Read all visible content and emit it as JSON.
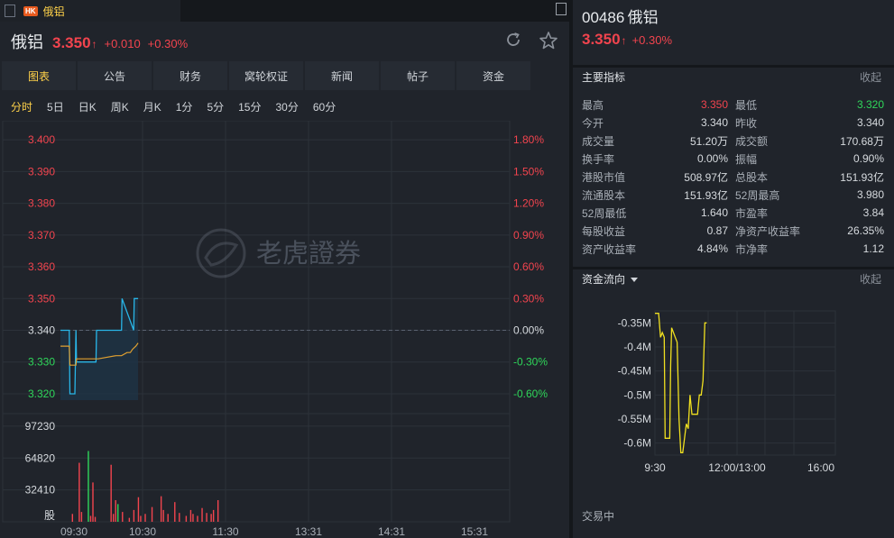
{
  "window": {
    "tab_badge": "HK",
    "tab_title": "俄铝"
  },
  "stock": {
    "name": "俄铝",
    "code": "00486",
    "price": "3.350",
    "change": "+0.010",
    "change_pct": "+0.30%",
    "arrow": "↑"
  },
  "nav_tabs": [
    "图表",
    "公告",
    "财务",
    "窝轮权证",
    "新闻",
    "帖子",
    "资金"
  ],
  "periods": [
    "分时",
    "5日",
    "日K",
    "周K",
    "月K",
    "1分",
    "5分",
    "15分",
    "30分",
    "60分"
  ],
  "watermark": "老虎證券",
  "chart_data": [
    {
      "type": "line",
      "y_ticks": [
        "3.400",
        "3.390",
        "3.380",
        "3.370",
        "3.360",
        "3.350",
        "3.340",
        "3.330",
        "3.320"
      ],
      "pct_ticks": [
        "1.80%",
        "1.50%",
        "1.20%",
        "0.90%",
        "0.60%",
        "0.30%",
        "0.00%",
        "-0.30%",
        "-0.60%"
      ],
      "x_ticks": [
        "09:30",
        "10:30",
        "11:30",
        "13:31",
        "14:31",
        "15:31"
      ],
      "ylim": [
        3.318,
        3.406
      ],
      "prev_close": 3.34,
      "series": [
        {
          "x": [
            0,
            8,
            8.5,
            12,
            13,
            14,
            14.5,
            24,
            24.5,
            32,
            32.5,
            37,
            37.5,
            49,
            50,
            55,
            55.5,
            66,
            66.5,
            70
          ],
          "values": [
            3.34,
            3.34,
            3.32,
            3.32,
            3.32,
            3.34,
            3.33,
            3.33,
            3.33,
            3.33,
            3.34,
            3.34,
            3.34,
            3.34,
            3.34,
            3.34,
            3.35,
            3.34,
            3.35,
            3.35
          ]
        },
        {
          "x": [
            0,
            8,
            8.5,
            14,
            14.5,
            24,
            34,
            50,
            55,
            60,
            63,
            65,
            68,
            70
          ],
          "values": [
            3.335,
            3.335,
            3.329,
            3.329,
            3.331,
            3.331,
            3.331,
            3.332,
            3.332,
            3.333,
            3.333,
            3.334,
            3.335,
            3.336
          ]
        }
      ]
    },
    {
      "type": "bar",
      "y_ticks": [
        "97230",
        "64820",
        "32410",
        "股"
      ],
      "ylim": [
        0,
        110000
      ],
      "bars": [
        {
          "x": 5,
          "v": 8000,
          "c": "red"
        },
        {
          "x": 8,
          "v": 60000,
          "c": "red"
        },
        {
          "x": 9,
          "v": 10000,
          "c": "red"
        },
        {
          "x": 12,
          "v": 72000,
          "c": "green"
        },
        {
          "x": 13,
          "v": 6000,
          "c": "red"
        },
        {
          "x": 14,
          "v": 40000,
          "c": "red"
        },
        {
          "x": 15,
          "v": 5000,
          "c": "red"
        },
        {
          "x": 22,
          "v": 58000,
          "c": "red"
        },
        {
          "x": 23,
          "v": 8000,
          "c": "red"
        },
        {
          "x": 24,
          "v": 22000,
          "c": "red"
        },
        {
          "x": 25,
          "v": 18000,
          "c": "green"
        },
        {
          "x": 27,
          "v": 10000,
          "c": "red"
        },
        {
          "x": 30,
          "v": 4000,
          "c": "red"
        },
        {
          "x": 32,
          "v": 12000,
          "c": "red"
        },
        {
          "x": 34,
          "v": 25000,
          "c": "red"
        },
        {
          "x": 35,
          "v": 6000,
          "c": "red"
        },
        {
          "x": 37,
          "v": 8000,
          "c": "red"
        },
        {
          "x": 40,
          "v": 15000,
          "c": "red"
        },
        {
          "x": 44,
          "v": 26000,
          "c": "red"
        },
        {
          "x": 45,
          "v": 12000,
          "c": "red"
        },
        {
          "x": 47,
          "v": 8000,
          "c": "red"
        },
        {
          "x": 50,
          "v": 20000,
          "c": "red"
        },
        {
          "x": 52,
          "v": 9000,
          "c": "red"
        },
        {
          "x": 55,
          "v": 6000,
          "c": "red"
        },
        {
          "x": 57,
          "v": 12000,
          "c": "red"
        },
        {
          "x": 58,
          "v": 8000,
          "c": "red"
        },
        {
          "x": 60,
          "v": 6000,
          "c": "red"
        },
        {
          "x": 62,
          "v": 14000,
          "c": "red"
        },
        {
          "x": 64,
          "v": 9000,
          "c": "red"
        },
        {
          "x": 66,
          "v": 8000,
          "c": "red"
        },
        {
          "x": 67,
          "v": 12000,
          "c": "red"
        },
        {
          "x": 69,
          "v": 22000,
          "c": "red"
        }
      ]
    },
    {
      "type": "line",
      "title": "资金流向",
      "y_ticks": [
        "-0.35M",
        "-0.4M",
        "-0.45M",
        "-0.5M",
        "-0.55M",
        "-0.6M"
      ],
      "x_ticks": [
        "9:30",
        "12:00/13:00",
        "16:00"
      ],
      "ylim": [
        -0.625,
        -0.325
      ],
      "series": [
        {
          "x": [
            0,
            2,
            3,
            4,
            5,
            5.5,
            8,
            8.5,
            9,
            10,
            11,
            12,
            13,
            14,
            15,
            16,
            17,
            18,
            19,
            20,
            21,
            22,
            23,
            24,
            25,
            26,
            27,
            28
          ],
          "values": [
            -0.33,
            -0.33,
            -0.38,
            -0.37,
            -0.38,
            -0.59,
            -0.59,
            -0.44,
            -0.36,
            -0.37,
            -0.38,
            -0.39,
            -0.55,
            -0.62,
            -0.62,
            -0.59,
            -0.56,
            -0.57,
            -0.5,
            -0.54,
            -0.54,
            -0.54,
            -0.54,
            -0.5,
            -0.5,
            -0.47,
            -0.35,
            -0.35
          ]
        }
      ]
    }
  ],
  "quote_panel": {
    "section_title": "主要指标",
    "collapse_label": "收起",
    "metrics": [
      {
        "l1": "最高",
        "v1": "3.350",
        "c1": "red",
        "l2": "最低",
        "v2": "3.320",
        "c2": "green"
      },
      {
        "l1": "今开",
        "v1": "3.340",
        "c1": "",
        "l2": "昨收",
        "v2": "3.340",
        "c2": ""
      },
      {
        "l1": "成交量",
        "v1": "51.20万",
        "c1": "",
        "l2": "成交额",
        "v2": "170.68万",
        "c2": ""
      },
      {
        "l1": "换手率",
        "v1": "0.00%",
        "c1": "",
        "l2": "振幅",
        "v2": "0.90%",
        "c2": ""
      },
      {
        "l1": "港股市值",
        "v1": "508.97亿",
        "c1": "",
        "l2": "总股本",
        "v2": "151.93亿",
        "c2": ""
      },
      {
        "l1": "流通股本",
        "v1": "151.93亿",
        "c1": "",
        "l2": "52周最高",
        "v2": "3.980",
        "c2": ""
      },
      {
        "l1": "52周最低",
        "v1": "1.640",
        "c1": "",
        "l2": "市盈率",
        "v2": "3.84",
        "c2": ""
      },
      {
        "l1": "每股收益",
        "v1": "0.87",
        "c1": "",
        "l2": "净资产收益率",
        "v2": "26.35%",
        "c2": ""
      },
      {
        "l1": "资产收益率",
        "v1": "4.84%",
        "c1": "",
        "l2": "市净率",
        "v2": "1.12",
        "c2": ""
      }
    ],
    "flow_title": "资金流向",
    "flow_collapse": "收起",
    "trade_status": "交易中"
  },
  "colors": {
    "up": "#f2444e",
    "down": "#2fd65a",
    "price_line": "#29b6e8",
    "avg_line": "#e0a030",
    "flow_line": "#f0e020",
    "active": "#ffd24a"
  }
}
